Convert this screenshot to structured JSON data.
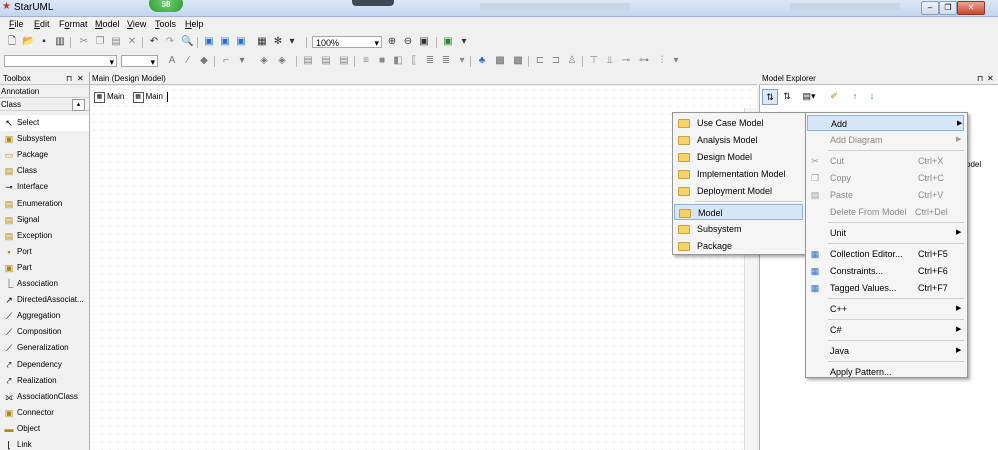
{
  "window": {
    "title": "StarUML",
    "badge": "58",
    "controls": [
      "‒",
      "❐",
      "✕"
    ]
  },
  "menubar": [
    {
      "label": "File",
      "key": "F"
    },
    {
      "label": "Edit",
      "key": "E"
    },
    {
      "label": "Format",
      "key": "o"
    },
    {
      "label": "Model",
      "key": "M"
    },
    {
      "label": "View",
      "key": "V"
    },
    {
      "label": "Tools",
      "key": "T"
    },
    {
      "label": "Help",
      "key": "H"
    }
  ],
  "toolbar": {
    "zoom_value": "100%"
  },
  "toolbox": {
    "title": "Toolbox",
    "pin": "⊓",
    "close": "✕",
    "group_annotation": "Annotation",
    "group_class": "Class",
    "items": [
      {
        "label": "Select",
        "icon": "arrow-cursor-icon",
        "glyph": "↖"
      },
      {
        "label": "Subsystem",
        "icon": "subsystem-icon",
        "glyph": "▣"
      },
      {
        "label": "Package",
        "icon": "package-icon",
        "glyph": "▭"
      },
      {
        "label": "Class",
        "icon": "class-icon",
        "glyph": "▤"
      },
      {
        "label": "Interface",
        "icon": "interface-icon",
        "glyph": "⊸"
      },
      {
        "label": "Enumeration",
        "icon": "enumeration-icon",
        "glyph": "▤"
      },
      {
        "label": "Signal",
        "icon": "signal-icon",
        "glyph": "▤"
      },
      {
        "label": "Exception",
        "icon": "exception-icon",
        "glyph": "▤"
      },
      {
        "label": "Port",
        "icon": "port-icon",
        "glyph": "▪"
      },
      {
        "label": "Part",
        "icon": "part-icon",
        "glyph": "▣"
      },
      {
        "label": "Association",
        "icon": "association-icon",
        "glyph": "⎿"
      },
      {
        "label": "DirectedAssociat...",
        "icon": "directed-association-icon",
        "glyph": "↗"
      },
      {
        "label": "Aggregation",
        "icon": "aggregation-icon",
        "glyph": "⟋"
      },
      {
        "label": "Composition",
        "icon": "composition-icon",
        "glyph": "⟋"
      },
      {
        "label": "Generalization",
        "icon": "generalization-icon",
        "glyph": "⟋"
      },
      {
        "label": "Dependency",
        "icon": "dependency-icon",
        "glyph": "⤤"
      },
      {
        "label": "Realization",
        "icon": "realization-icon",
        "glyph": "⤤"
      },
      {
        "label": "AssociationClass",
        "icon": "association-class-icon",
        "glyph": "⟗"
      },
      {
        "label": "Connector",
        "icon": "connector-icon",
        "glyph": "▣"
      },
      {
        "label": "Object",
        "icon": "object-icon",
        "glyph": "▬"
      },
      {
        "label": "Link",
        "icon": "link-icon",
        "glyph": "⌊"
      }
    ]
  },
  "main": {
    "title": "Main (Design Model)",
    "tabs": [
      "Main",
      "Main"
    ]
  },
  "explorer": {
    "title": "Model Explorer",
    "partial_text": "odel",
    "pin": "⊓",
    "close": "✕"
  },
  "context_menu": {
    "items": [
      {
        "label": "Add",
        "shortcut": "",
        "submenu": true,
        "disabled": false,
        "highlight": true
      },
      {
        "label": "Add Diagram",
        "shortcut": "",
        "submenu": true,
        "disabled": true
      },
      {
        "sep": true
      },
      {
        "label": "Cut",
        "shortcut": "Ctrl+X",
        "disabled": true,
        "icon": "scissors-icon",
        "glyph": "✂"
      },
      {
        "label": "Copy",
        "shortcut": "Ctrl+C",
        "disabled": true,
        "icon": "copy-icon",
        "glyph": "❐"
      },
      {
        "label": "Paste",
        "shortcut": "Ctrl+V",
        "disabled": true,
        "icon": "paste-icon",
        "glyph": "▤"
      },
      {
        "label": "Delete From Model",
        "shortcut": "Ctrl+Del",
        "disabled": true
      },
      {
        "sep": true
      },
      {
        "label": "Unit",
        "shortcut": "",
        "submenu": true,
        "disabled": false
      },
      {
        "sep": true
      },
      {
        "label": "Collection Editor...",
        "shortcut": "Ctrl+F5",
        "disabled": false,
        "icon": "collection-editor-icon",
        "glyph": "▦"
      },
      {
        "label": "Constraints...",
        "shortcut": "Ctrl+F6",
        "disabled": false,
        "icon": "constraints-icon",
        "glyph": "▦"
      },
      {
        "label": "Tagged Values...",
        "shortcut": "Ctrl+F7",
        "disabled": false,
        "icon": "tagged-values-icon",
        "glyph": "▦"
      },
      {
        "sep": true
      },
      {
        "label": "C++",
        "shortcut": "",
        "submenu": true,
        "disabled": false
      },
      {
        "sep": true
      },
      {
        "label": "C#",
        "shortcut": "",
        "submenu": true,
        "disabled": false
      },
      {
        "sep": true
      },
      {
        "label": "Java",
        "shortcut": "",
        "submenu": true,
        "disabled": false
      },
      {
        "sep": true
      },
      {
        "label": "Apply Pattern...",
        "shortcut": "",
        "disabled": false
      }
    ]
  },
  "add_submenu": {
    "items": [
      {
        "label": "Use Case Model",
        "icon": "use-case-model-icon"
      },
      {
        "label": "Analysis Model",
        "icon": "analysis-model-icon"
      },
      {
        "label": "Design Model",
        "icon": "design-model-icon"
      },
      {
        "label": "Implementation Model",
        "icon": "implementation-model-icon"
      },
      {
        "label": "Deployment Model",
        "icon": "deployment-model-icon"
      },
      {
        "sep": true
      },
      {
        "label": "Model",
        "icon": "model-icon",
        "highlight": true
      },
      {
        "label": "Subsystem",
        "icon": "subsystem-icon"
      },
      {
        "label": "Package",
        "icon": "package-icon"
      }
    ]
  },
  "colors": {
    "highlight_bg": "#d6e6f7",
    "highlight_border": "#8fb3dd",
    "disabled_text": "#8a8a8a"
  }
}
